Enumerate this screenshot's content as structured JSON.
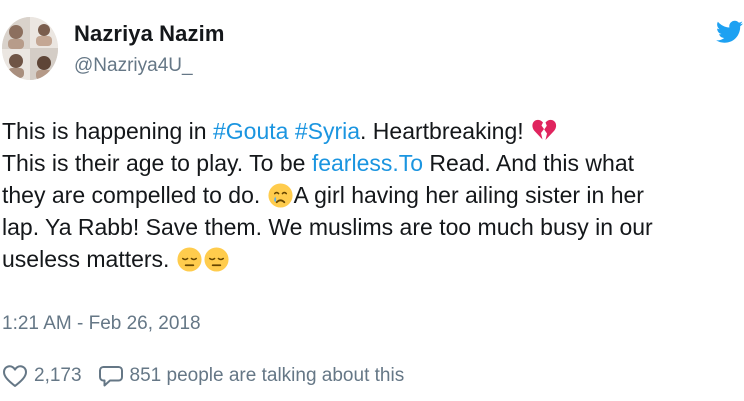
{
  "user": {
    "name": "Nazriya Nazim",
    "handle": "@Nazriya4U_"
  },
  "tweet": {
    "l1_pre": "This is happening in ",
    "l1_tag1": "#Gouta",
    "l1_sp": " ",
    "l1_tag2": "#Syria",
    "l1_post": ". Heartbreaking! ",
    "l2_pre": "This is their age to play. To be ",
    "l2_link": "fearless.To",
    "l2_post": " Read. And this what",
    "l3_pre": "they are compelled to do. ",
    "l3_post": "A girl having her ailing sister in her",
    "l4": "lap. Ya Rabb! Save them. We muslims are too much busy in our",
    "l5": "useless matters. "
  },
  "timestamp": "1:21 AM - Feb 26, 2018",
  "likes": "2,173",
  "talking": "851 people are talking about this",
  "icons": {
    "bird": "twitter-bird-icon",
    "broken_heart": "broken-heart-emoji",
    "crying": "crying-face-emoji",
    "pensive": "pensive-face-emoji",
    "heart": "heart-outline-icon",
    "reply": "speech-bubble-icon"
  },
  "colors": {
    "link": "#1b95e0",
    "secondary": "#657786",
    "bird": "#1da1f2",
    "text": "#14171a"
  }
}
